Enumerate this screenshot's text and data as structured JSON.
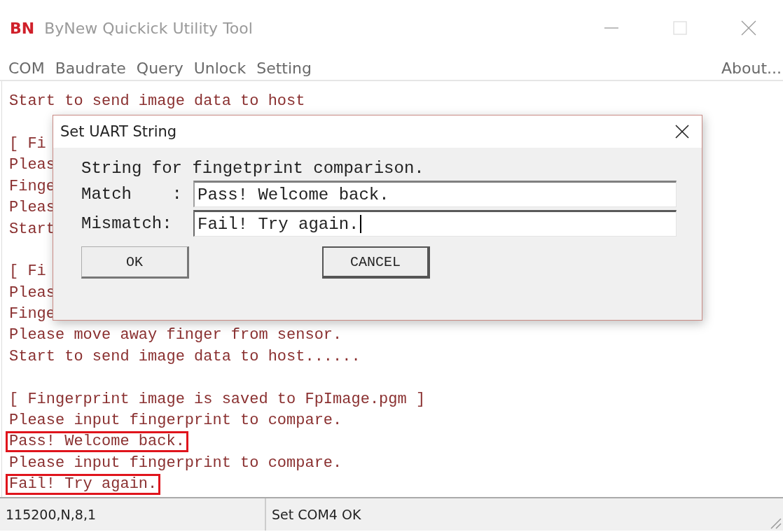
{
  "window": {
    "logo": "BN",
    "title": "ByNew Quickick Utility Tool"
  },
  "menu": {
    "items": [
      {
        "label": "COM"
      },
      {
        "label": "Baudrate"
      },
      {
        "label": "Query"
      },
      {
        "label": "Unlock"
      },
      {
        "label": "Setting"
      }
    ],
    "about": "About..."
  },
  "log": {
    "lines": [
      {
        "kind": "text",
        "text": "Start to send image data to host",
        "highlighted": false
      },
      {
        "kind": "blank"
      },
      {
        "kind": "text",
        "text": "[ Fi",
        "highlighted": false
      },
      {
        "kind": "text",
        "text": "Pleas",
        "highlighted": false
      },
      {
        "kind": "text",
        "text": "Finge",
        "highlighted": false
      },
      {
        "kind": "text",
        "text": "Pleas",
        "highlighted": false
      },
      {
        "kind": "text",
        "text": "Start",
        "highlighted": false
      },
      {
        "kind": "blank"
      },
      {
        "kind": "text",
        "text": "[ Fi",
        "highlighted": false
      },
      {
        "kind": "text",
        "text": "Pleas",
        "highlighted": false
      },
      {
        "kind": "text",
        "text": "Finge",
        "highlighted": false
      },
      {
        "kind": "text",
        "text": "Please move away finger from sensor.",
        "highlighted": false
      },
      {
        "kind": "text",
        "text": "Start to send image data to host......",
        "highlighted": false
      },
      {
        "kind": "blank"
      },
      {
        "kind": "text",
        "text": "[ Fingerprint image is saved to FpImage.pgm ]",
        "highlighted": false
      },
      {
        "kind": "text",
        "text": "Please input fingerprint to compare.",
        "highlighted": false
      },
      {
        "kind": "text",
        "text": "Pass! Welcome back.",
        "highlighted": true
      },
      {
        "kind": "text",
        "text": "Please input fingerprint to compare.",
        "highlighted": false
      },
      {
        "kind": "text",
        "text": "Fail! Try again.",
        "highlighted": true
      }
    ]
  },
  "dialog": {
    "title": "Set UART String",
    "prompt": "String for fingetprint comparison.",
    "fields": [
      {
        "label": "Match    :",
        "value": "Pass! Welcome back.",
        "focused": false
      },
      {
        "label": "Mismatch:",
        "value": "Fail! Try again.",
        "focused": true
      }
    ],
    "buttons": [
      {
        "label": "OK",
        "default": false
      },
      {
        "label": "CANCEL",
        "default": true
      }
    ]
  },
  "status_bar": {
    "panes": [
      "115200,N,8,1",
      "Set COM4 OK"
    ]
  }
}
